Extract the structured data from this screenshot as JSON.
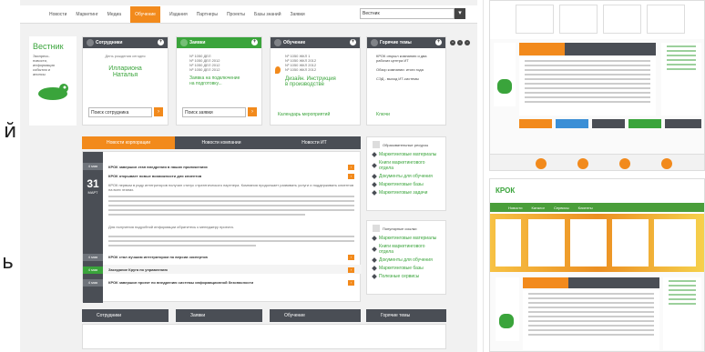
{
  "side_letters": [
    "й",
    "ь"
  ],
  "nav": {
    "items": [
      "Новости",
      "Маркетинг",
      "Медиа",
      "Обучение",
      "Издания",
      "Партнеры",
      "Проекты",
      "Базы знаний",
      "Заявки"
    ],
    "active_index": 3,
    "search_value": "Вестник",
    "search_button": "▾"
  },
  "vestnik": {
    "title": "Вестник",
    "lines": [
      "Экспресс-",
      "новости,",
      "информация",
      "события и",
      "анонсы"
    ]
  },
  "cards": {
    "employees": {
      "title": "Сотрудники",
      "line1": "День рождения сегодня",
      "name1": "Иллариона",
      "name2": "Наталья",
      "select": "Поиск сотрудника",
      "button": "›"
    },
    "requests": {
      "title": "Заявки",
      "lines": [
        "Nº 1050 ДЕЛ",
        "Nº 1050 ДЕЛ 2012",
        "Nº 1050 ДЕЛ 2012",
        "Nº 1050 ДЕЛ 2012"
      ],
      "link1": "Заявка на подключение",
      "link2": "на подготовку...",
      "select": "Поиск заявки",
      "button": "›"
    },
    "training": {
      "title": "Обучение",
      "lines": [
        "Nº 1050 ЖКЛ 1",
        "Nº 1050 ЖКЛ 2012",
        "Nº 1050 ЖКЛ 2012",
        "Nº 1050 ЖКЛ 2012"
      ],
      "link1": "Дизайн. Инструкция",
      "link2": "в производстве",
      "footer": "Календарь мероприятий"
    },
    "hot": {
      "title": "Горячие темы",
      "items": [
        "КРОК открыл компанию и два рабочих центра ИТ",
        "Обзор компании: итоги года",
        "СЭД - выход ИТ-системы"
      ],
      "footer": "Ключи"
    }
  },
  "tabs": {
    "items": [
      "Новости корпорации",
      "Новости компании",
      "Новости ИТ"
    ],
    "active_index": 0
  },
  "news": {
    "date_day": "31",
    "date_month": "МАРТ",
    "date_top": "4 мая",
    "date_tags": [
      "4 мая",
      "4 мая",
      "4 мая"
    ],
    "headlines": [
      "КРОК завершил этап внедрения в наших приложениях",
      "КРОК открывает новые возможности для клиентов",
      "КРОК стал лучшим интегратором по версии экспертов",
      "Заседание Круга по управлению",
      "КРОК завершил проект по внедрению системы информационной безопасности"
    ],
    "paragraph": "КРОК первым в ряду интеграторов получил статус стратегического партнера. Компания продолжает развивать услуги и поддерживать клиентов на всех этапах.",
    "paragraph2": "Для получения подробной информации обратитесь к менеджеру проекта."
  },
  "right_panels": {
    "p1": {
      "title": "Образовательные ресурсы",
      "items": [
        "Маркетинговые материалы",
        "Книги маркетингового отдела",
        "Документы для обучения",
        "Маркетинговые базы",
        "Маркетинговые задачи"
      ]
    },
    "p2": {
      "title": "Популярные ссылки",
      "items": [
        "Маркетинговые материалы",
        "Книги маркетингового отдела",
        "Документы для обучения",
        "Маркетинговые базы",
        "Полезные сервисы"
      ]
    }
  },
  "bottom_bar": {
    "items": [
      "Сотрудники",
      "Заявки",
      "Обучение",
      "Горячие темы"
    ]
  },
  "thumbnails": {
    "logo": "КРОК",
    "tabs": [
      "Новости",
      "Каталог",
      "Сервисы",
      "Клиенты"
    ]
  },
  "colors": {
    "orange": "#f28a1c",
    "dark": "#4a4e55",
    "green": "#3aa43b"
  }
}
